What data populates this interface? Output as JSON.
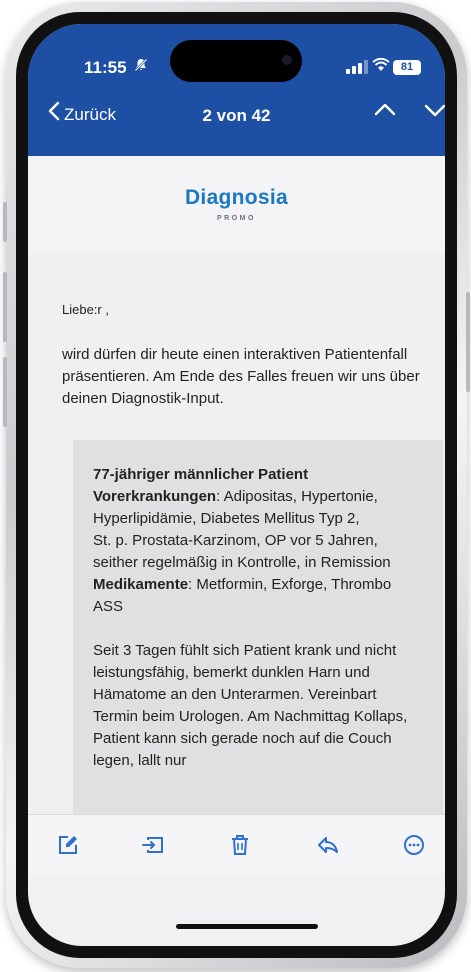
{
  "status_bar": {
    "time": "11:55",
    "battery": "81"
  },
  "nav": {
    "back_label": "Zurück",
    "counter": "2 von 42"
  },
  "brand": {
    "name": "Diagnosia",
    "sub_left": "",
    "sub_mid": "PROMO",
    "sub_right": ""
  },
  "mail": {
    "greeting": "Liebe:r ,",
    "intro": "wird dürfen dir heute einen interaktiven Patientenfall präsentieren. Am Ende des Falles freuen wir  uns über deinen Diagnostik-Input.",
    "case": {
      "title": "77-jähriger männlicher Patient",
      "conditions_label": "Vorerkrankungen",
      "conditions_text": ": Adipositas, Hypertonie, Hyperlipidämie, Diabetes Mellitus Typ 2,",
      "history": "St. p. Prostata-Karzinom, OP vor 5 Jahren, seither regelmäßig in Kontrolle, in Remission",
      "meds_label": "Medikamente",
      "meds_text": ": Metformin, Exforge, Thrombo ASS",
      "story": "Seit 3 Tagen fühlt sich Patient krank und nicht leistungsfähig, bemerkt dunklen Harn und Hämatome an den Unterarmen. Vereinbart Termin beim Urologen. Am Nachmittag Kollaps, Patient kann sich gerade noch auf die Couch legen, lallt nur"
    }
  },
  "toolbar": {
    "items": [
      "compose-icon",
      "move-to-folder-icon",
      "trash-icon",
      "reply-icon",
      "more-icon"
    ]
  },
  "colors": {
    "header": "#1d4fa5",
    "brand": "#1b78c2",
    "toolbar_icon": "#2f6fd0"
  }
}
